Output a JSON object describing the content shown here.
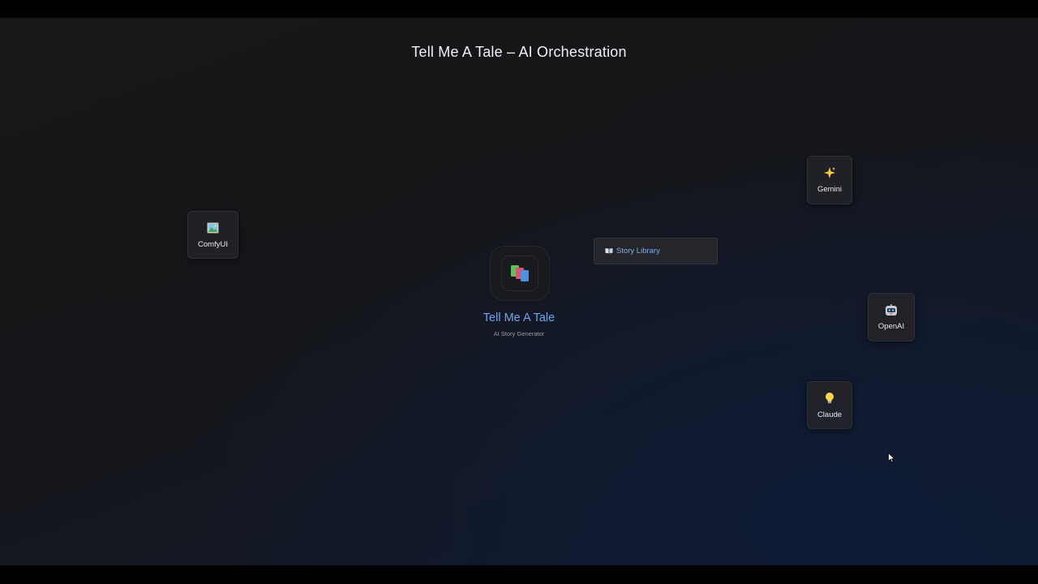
{
  "page": {
    "title": "Tell Me A Tale – AI Orchestration"
  },
  "hub": {
    "title": "Tell Me A Tale",
    "subtitle": "AI Story Generator",
    "icon": "books-icon"
  },
  "library": {
    "label": "Story Library",
    "icon": "open-book-icon"
  },
  "nodes": {
    "comfyui": {
      "label": "ComfyUI",
      "icon": "framed-picture-icon"
    },
    "gemini": {
      "label": "Gemini",
      "icon": "sparkles-icon"
    },
    "openai": {
      "label": "OpenAI",
      "icon": "robot-icon"
    },
    "claude": {
      "label": "Claude",
      "icon": "light-bulb-icon"
    }
  },
  "colors": {
    "accent": "#6ea5f0",
    "background": "#151619",
    "node": "#222328"
  }
}
